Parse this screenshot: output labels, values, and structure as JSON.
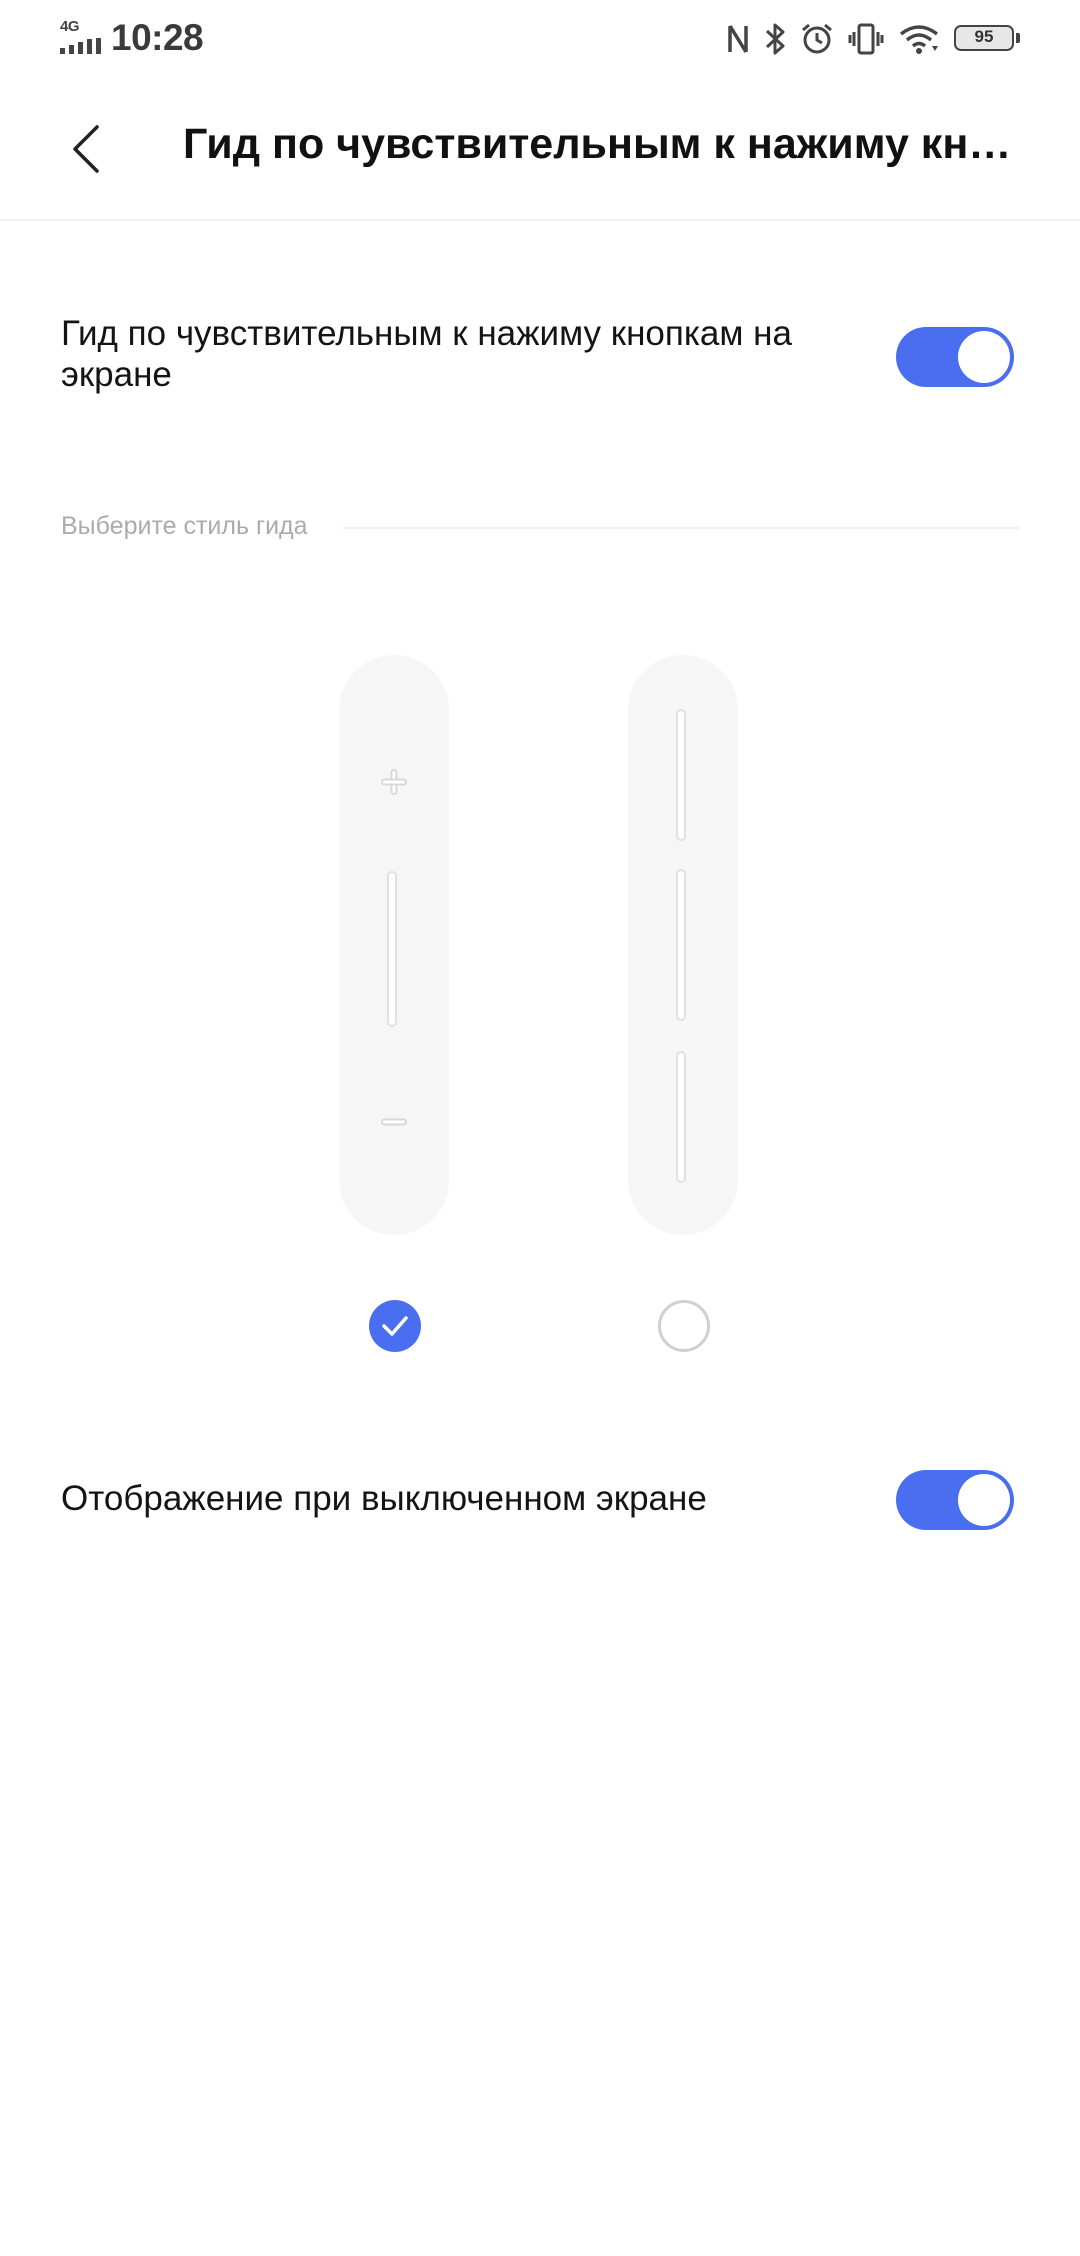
{
  "status_bar": {
    "network": "4G",
    "time": "10:28",
    "battery": "95",
    "icons": [
      "nfc-icon",
      "bluetooth-icon",
      "alarm-icon",
      "vibrate-icon",
      "wifi-icon",
      "battery-icon"
    ]
  },
  "header": {
    "title": "Гид по чувствительным к нажиму кно…"
  },
  "settings": {
    "guide_toggle": {
      "label": "Гид по чувствительным к нажиму кнопкам на экране",
      "on": true
    },
    "style_section": {
      "label": "Выберите стиль гида"
    },
    "styles": [
      {
        "name": "plus-minus-style",
        "selected": true
      },
      {
        "name": "three-segments-style",
        "selected": false
      }
    ],
    "screen_off_toggle": {
      "label": "Отображение при выключенном экране",
      "on": true
    }
  },
  "colors": {
    "accent": "#4a6ef0",
    "background": "#ffffff",
    "pill": "#f6f6f6",
    "section_label": "#ababab"
  }
}
